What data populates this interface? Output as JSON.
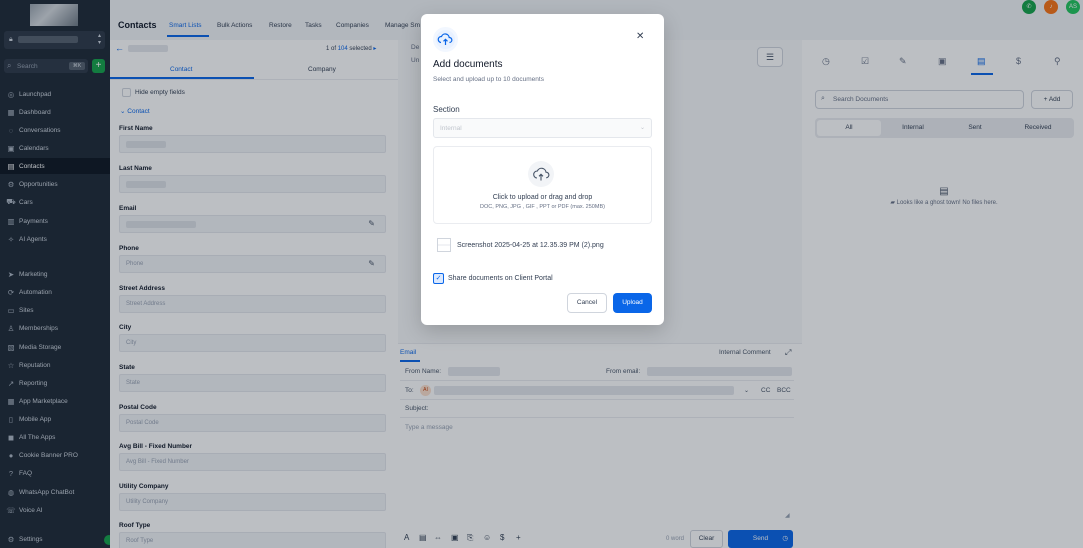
{
  "sidebar": {
    "search_placeholder": "Search",
    "search_shortcut": "⌘K",
    "nav": [
      {
        "label": "Launchpad",
        "icon": "rocket-icon",
        "glyph": "◎"
      },
      {
        "label": "Dashboard",
        "icon": "dashboard-icon",
        "glyph": "▦"
      },
      {
        "label": "Conversations",
        "icon": "chat-icon",
        "glyph": "◌"
      },
      {
        "label": "Calendars",
        "icon": "calendar-icon",
        "glyph": "▣"
      },
      {
        "label": "Contacts",
        "icon": "contacts-icon",
        "glyph": "▤"
      },
      {
        "label": "Opportunities",
        "icon": "opportunities-icon",
        "glyph": "⚙"
      },
      {
        "label": "Cars",
        "icon": "car-icon",
        "glyph": "⛟"
      },
      {
        "label": "Payments",
        "icon": "payments-icon",
        "glyph": "▥"
      },
      {
        "label": "AI Agents",
        "icon": "ai-agents-icon",
        "glyph": "✧"
      },
      {
        "label": "Marketing",
        "icon": "marketing-icon",
        "glyph": "➤"
      },
      {
        "label": "Automation",
        "icon": "automation-icon",
        "glyph": "⟳"
      },
      {
        "label": "Sites",
        "icon": "sites-icon",
        "glyph": "▭"
      },
      {
        "label": "Memberships",
        "icon": "memberships-icon",
        "glyph": "♙"
      },
      {
        "label": "Media Storage",
        "icon": "media-storage-icon",
        "glyph": "▧"
      },
      {
        "label": "Reputation",
        "icon": "reputation-icon",
        "glyph": "☆"
      },
      {
        "label": "Reporting",
        "icon": "reporting-icon",
        "glyph": "↗"
      },
      {
        "label": "App Marketplace",
        "icon": "app-marketplace-icon",
        "glyph": "▦"
      },
      {
        "label": "Mobile App",
        "icon": "mobile-app-icon",
        "glyph": "▯"
      },
      {
        "label": "All The Apps",
        "icon": "all-apps-icon",
        "glyph": "◼"
      },
      {
        "label": "Cookie Banner PRO",
        "icon": "cookie-icon",
        "glyph": "●"
      },
      {
        "label": "FAQ",
        "icon": "faq-icon",
        "glyph": "?"
      },
      {
        "label": "WhatsApp ChatBot",
        "icon": "whatsapp-icon",
        "glyph": "◍"
      },
      {
        "label": "Voice AI",
        "icon": "voice-ai-icon",
        "glyph": "☏"
      },
      {
        "label": "Settings",
        "icon": "settings-icon",
        "glyph": "⚙"
      }
    ]
  },
  "topbar": {
    "title": "Contacts",
    "tabs": [
      "Smart Lists",
      "Bulk Actions",
      "Restore",
      "Tasks",
      "Companies",
      "Manage Sm"
    ],
    "avatar_initials": "AS"
  },
  "contact_panel": {
    "pagination": {
      "prefix": "1 of",
      "count": "104",
      "suffix": "selected"
    },
    "tabs": [
      "Contact",
      "Company"
    ],
    "hide_empty": "Hide empty fields",
    "section": "Contact",
    "fields": [
      {
        "label": "First Name",
        "placeholder": ""
      },
      {
        "label": "Last Name",
        "placeholder": ""
      },
      {
        "label": "Email",
        "placeholder": ""
      },
      {
        "label": "Phone",
        "placeholder": "Phone"
      },
      {
        "label": "Street Address",
        "placeholder": "Street Address"
      },
      {
        "label": "City",
        "placeholder": "City"
      },
      {
        "label": "State",
        "placeholder": "State"
      },
      {
        "label": "Postal Code",
        "placeholder": "Postal Code"
      },
      {
        "label": "Avg Bill - Fixed Number",
        "placeholder": "Avg Bill - Fixed Number"
      },
      {
        "label": "Utility Company",
        "placeholder": "Utility Company"
      },
      {
        "label": "Roof Type",
        "placeholder": "Roof Type"
      }
    ]
  },
  "middle": {
    "frag1": "De",
    "frag2": "Un"
  },
  "compose": {
    "tab_email": "Email",
    "internal_comment": "Internal Comment",
    "from_name": "From Name:",
    "from_email": "From email:",
    "to": "To:",
    "to_avatar": "AI",
    "cc": "CC",
    "bcc": "BCC",
    "subject": "Subject:",
    "message_placeholder": "Type a message",
    "word_count": "0 word",
    "clear": "Clear",
    "send": "Send",
    "tools": [
      "A",
      "▤",
      "⇔",
      "▣",
      "⎘",
      "☺",
      "$",
      "+"
    ]
  },
  "documents": {
    "search_placeholder": "Search Documents",
    "add": "+ Add",
    "segments": [
      "All",
      "Internal",
      "Sent",
      "Received"
    ],
    "empty": "Looks like a ghost town! No files here."
  },
  "modal": {
    "title": "Add documents",
    "subtitle": "Select and upload up to 10 documents",
    "section_label": "Section",
    "section_value": "Internal",
    "drop_text": "Click to upload or drag and drop",
    "drop_formats": "DOC, PNG, JPG , GIF , PPT or PDF (max. 250MB)",
    "file_name": "Screenshot 2025-04-25 at 12.35.39 PM (2).png",
    "share_label": "Share documents on Client Portal",
    "cancel": "Cancel",
    "upload": "Upload"
  },
  "colors": {
    "primary": "#0a66e8",
    "sidebar": "#1f2a37",
    "success": "#16a34a",
    "alert": "#f97316"
  }
}
